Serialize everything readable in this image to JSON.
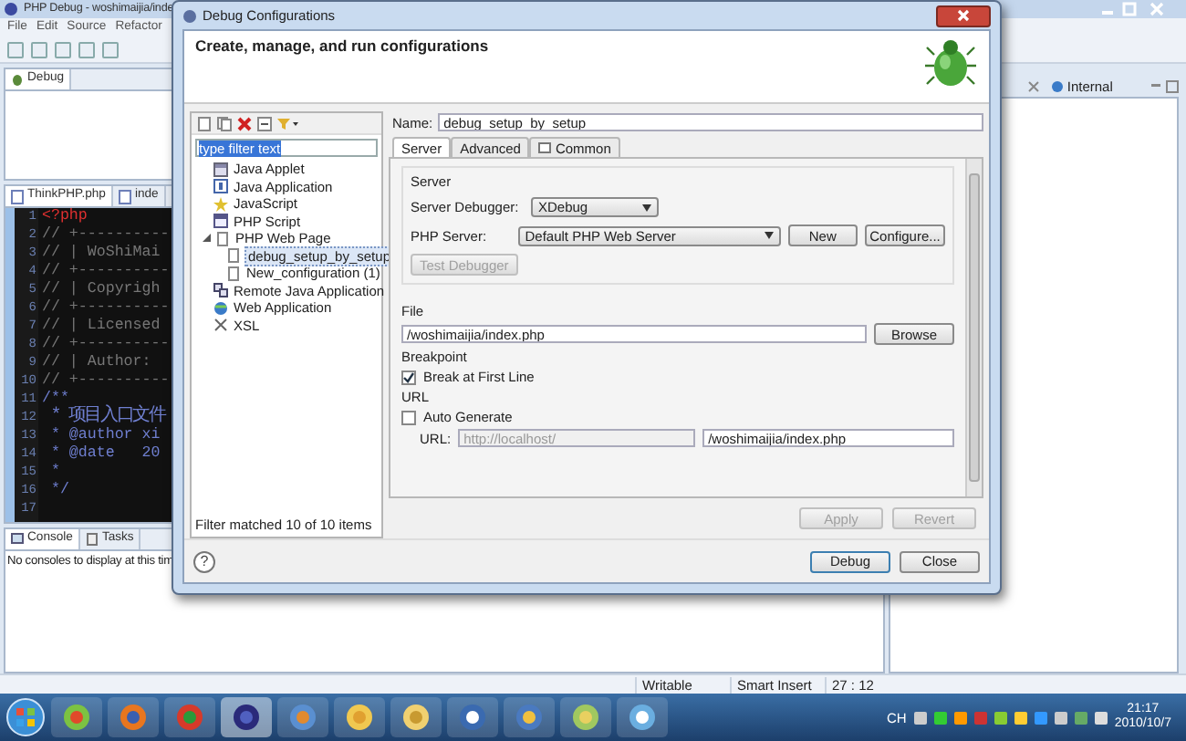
{
  "ide": {
    "title": "PHP Debug - woshimaijia/inde",
    "menu": [
      "File",
      "Edit",
      "Source",
      "Refactor"
    ],
    "debug_view": {
      "tab": "Debug"
    },
    "editor_tabs": [
      {
        "label": "ThinkPHP.php",
        "selected": true
      },
      {
        "label": "inde",
        "selected": false
      }
    ],
    "code_lines": [
      {
        "number": "1",
        "text": "<?php",
        "kind": "tag"
      },
      {
        "number": "2",
        "text": "// +----------",
        "kind": "comment"
      },
      {
        "number": "3",
        "text": "// | WoShiMai",
        "kind": "comment"
      },
      {
        "number": "4",
        "text": "// +----------",
        "kind": "comment"
      },
      {
        "number": "5",
        "text": "// | Copyrigh",
        "kind": "comment"
      },
      {
        "number": "6",
        "text": "// +----------",
        "kind": "comment"
      },
      {
        "number": "7",
        "text": "// | Licensed",
        "kind": "comment"
      },
      {
        "number": "8",
        "text": "// +----------",
        "kind": "comment"
      },
      {
        "number": "9",
        "text": "// | Author:",
        "kind": "comment"
      },
      {
        "number": "10",
        "text": "// +----------",
        "kind": "comment"
      },
      {
        "number": "11",
        "text": "/**",
        "kind": "doc"
      },
      {
        "number": "12",
        "text": " * 项目入口文件",
        "kind": "doc"
      },
      {
        "number": "13",
        "text": " * @author xi",
        "kind": "doc"
      },
      {
        "number": "14",
        "text": " * @date   20",
        "kind": "doc"
      },
      {
        "number": "15",
        "text": " *",
        "kind": "doc"
      },
      {
        "number": "16",
        "text": " */",
        "kind": "doc"
      },
      {
        "number": "17",
        "kind": "doc"
      }
    ],
    "console_tabs": [
      {
        "label": "Console",
        "selected": true
      },
      {
        "label": "Tasks",
        "selected": false
      }
    ],
    "console_message": "No consoles to display at this tim",
    "right_tabs": [
      {
        "label": "Internal"
      }
    ],
    "status_bar": [
      "Writable",
      "Smart Insert",
      "27 : 12"
    ]
  },
  "dialog": {
    "title": "Debug Configurations",
    "heading": "Create, manage, and run configurations",
    "filter": {
      "value": "type filter text"
    },
    "tree": [
      {
        "label": "Java Applet",
        "selected": false
      },
      {
        "label": "Java Application",
        "selected": false
      },
      {
        "label": "JavaScript",
        "selected": false
      },
      {
        "label": "PHP Script",
        "selected": false
      },
      {
        "label": "PHP Web Page",
        "selected": false,
        "expanded": true,
        "children": [
          {
            "label": "debug_setup_by_setup",
            "selected": true
          },
          {
            "label": "New_configuration (1)",
            "selected": false
          }
        ]
      },
      {
        "label": "Remote Java Application",
        "selected": false
      },
      {
        "label": "Web Application",
        "selected": false
      },
      {
        "label": "XSL",
        "selected": false
      }
    ],
    "filter_status": "Filter matched 10 of 10 items",
    "name": {
      "label": "Name:",
      "value": "debug_setup_by_setup"
    },
    "tabs": [
      {
        "label": "Server",
        "selected": true
      },
      {
        "label": "Advanced",
        "selected": false
      },
      {
        "label": "Common",
        "selected": false
      }
    ],
    "server": {
      "heading": "Server",
      "debugger_label": "Server Debugger:",
      "debugger_value": "XDebug",
      "php_server_label": "PHP Server:",
      "php_server_value": "Default PHP Web Server",
      "new_button": "New",
      "configure_button": "Configure...",
      "test_button": {
        "label": "Test Debugger",
        "disabled": true
      }
    },
    "file": {
      "heading": "File",
      "value": "/woshimaijia/index.php",
      "browse_button": "Browse"
    },
    "breakpoint": {
      "heading": "Breakpoint",
      "label": "Break at First Line",
      "checked": true
    },
    "url": {
      "heading": "URL",
      "auto_label": "Auto Generate",
      "auto_checked": false,
      "url_label": "URL:",
      "base": "http://localhost/",
      "path": "/woshimaijia/index.php"
    },
    "apply_button": {
      "label": "Apply",
      "disabled": true
    },
    "revert_button": {
      "label": "Revert",
      "disabled": true
    },
    "help_button": "?",
    "debug_button": "Debug",
    "close_button": "Close"
  },
  "taskbar": {
    "language": "CH",
    "time": "21:17",
    "date": "2010/10/7"
  }
}
